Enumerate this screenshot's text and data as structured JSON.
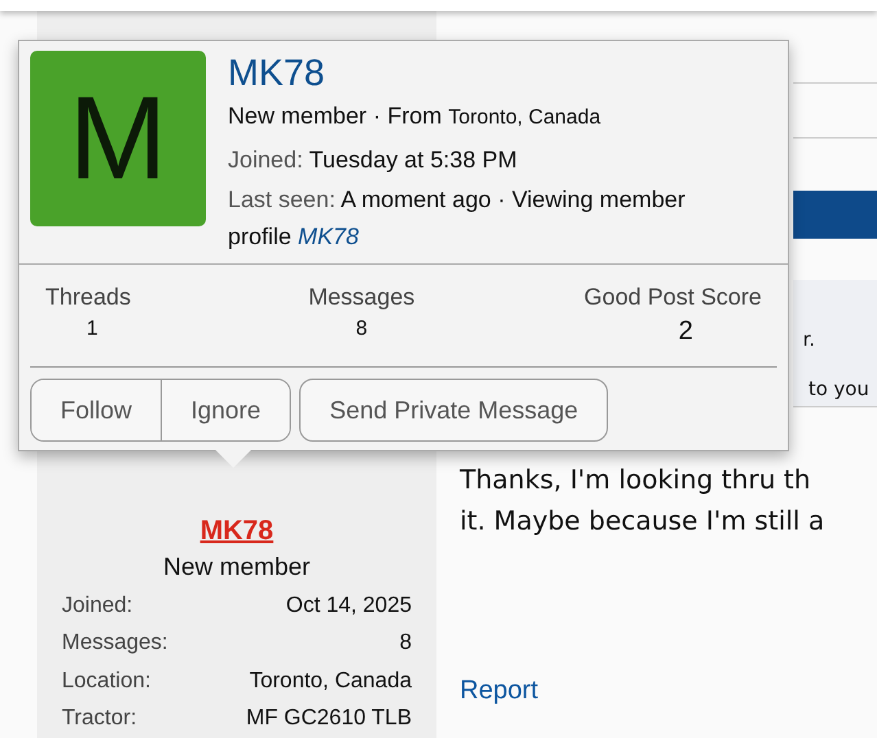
{
  "side_fragments": [
    "r.",
    "to you"
  ],
  "post": {
    "author": "MK78",
    "user_title": "New member",
    "info": [
      {
        "label": "Joined:",
        "value": "Oct 14, 2025"
      },
      {
        "label": "Messages:",
        "value": "8"
      },
      {
        "label": "Location:",
        "value": "Toronto, Canada"
      },
      {
        "label": "Tractor:",
        "value": "MF GC2610 TLB"
      }
    ],
    "body_lines": [
      "Thanks, I'm looking thru th",
      "it. Maybe because I'm still a"
    ],
    "report": "Report"
  },
  "popup": {
    "avatar_letter": "M",
    "name": "MK78",
    "user_title": "New member",
    "separator": "·",
    "from_label": "From",
    "location": "Toronto, Canada",
    "joined_label": "Joined:",
    "joined_value": "Tuesday at 5:38 PM",
    "last_seen_label": "Last seen:",
    "last_seen_text": "A moment ago · Viewing member profile",
    "last_seen_link": "MK78",
    "stats": [
      {
        "label": "Threads",
        "value": "1"
      },
      {
        "label": "Messages",
        "value": "8"
      },
      {
        "label": "Good Post Score",
        "value": "2"
      }
    ],
    "button_group": [
      "Follow",
      "Ignore"
    ],
    "buttons": [
      "Send Private Message"
    ]
  }
}
